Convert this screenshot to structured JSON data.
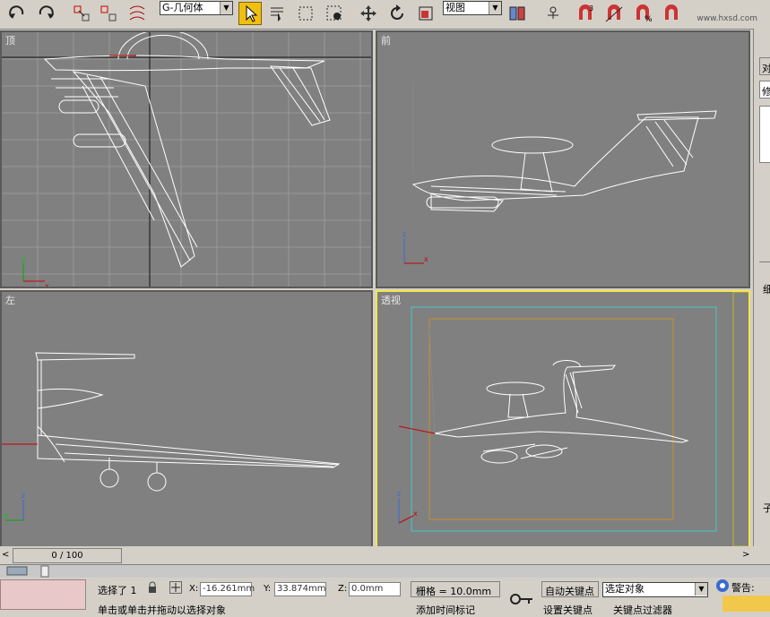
{
  "toolbar": {
    "selection_filter": "G-几何体",
    "reference_coord": "视图",
    "snap_label": "3",
    "watermark": "www.hxsd.com"
  },
  "viewports": {
    "top": "顶",
    "front": "前",
    "left": "左",
    "perspective": "透视"
  },
  "command_panel": {
    "tab1": "对",
    "tab2": "修",
    "t1": "细",
    "t2": "子"
  },
  "time_slider": {
    "frame": "0 / 100"
  },
  "status": {
    "selected": "选择了 1",
    "x_label": "X:",
    "x_value": "-16.261mm",
    "y_label": "Y:",
    "y_value": "33.874mm",
    "z_label": "Z:",
    "z_value": "0.0mm",
    "grid": "栅格 = 10.0mm",
    "auto_key": "自动关键点",
    "set_key": "设置关键点",
    "selected_obj": "选定对象",
    "key_filters": "关键点过滤器",
    "prompt": "单击或单击并拖动以选择对象",
    "add_time_tag": "添加时间标记",
    "warning": "警告:"
  }
}
